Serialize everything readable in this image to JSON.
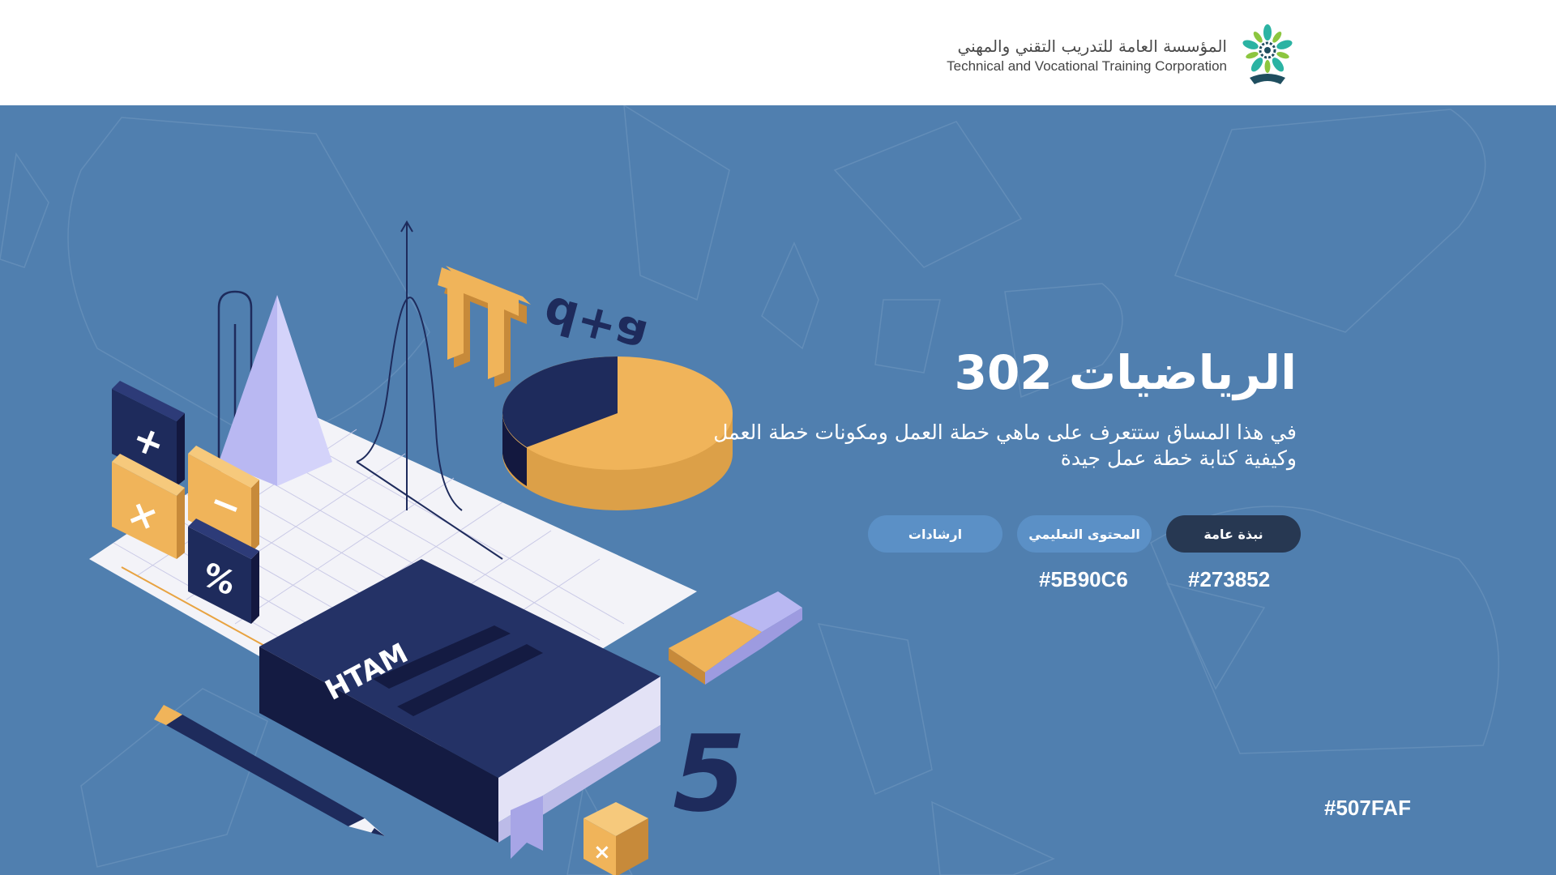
{
  "header": {
    "org_name_ar": "المؤسسة العامة للتدريب التقني والمهني",
    "org_name_en": "Technical and Vocational Training Corporation"
  },
  "course": {
    "title": "الرياضيات 302",
    "description": "في هذا المساق ستتعرف على ماهي خطة العمل ومكونات خطة العمل وكيفية كتابة خطة عمل جيدة"
  },
  "tabs": [
    {
      "label": "نبذة عامة",
      "state": "active"
    },
    {
      "label": "المحتوى التعليمي",
      "state": "inactive"
    },
    {
      "label": "ارشادات",
      "state": "inactive"
    }
  ],
  "swatches": {
    "active_tab": "#273852",
    "inactive_tab": "#5B90C6",
    "background": "#507FAF"
  },
  "illustration": {
    "book_label": "MATH",
    "formula": "d+a",
    "number": "5"
  },
  "colors": {
    "background": "#507FAF",
    "active_tab": "#273852",
    "inactive_tab": "#5B90C6",
    "navy": "#1E2B5C",
    "orange": "#F0B45A",
    "lavender": "#B9B8F2"
  }
}
